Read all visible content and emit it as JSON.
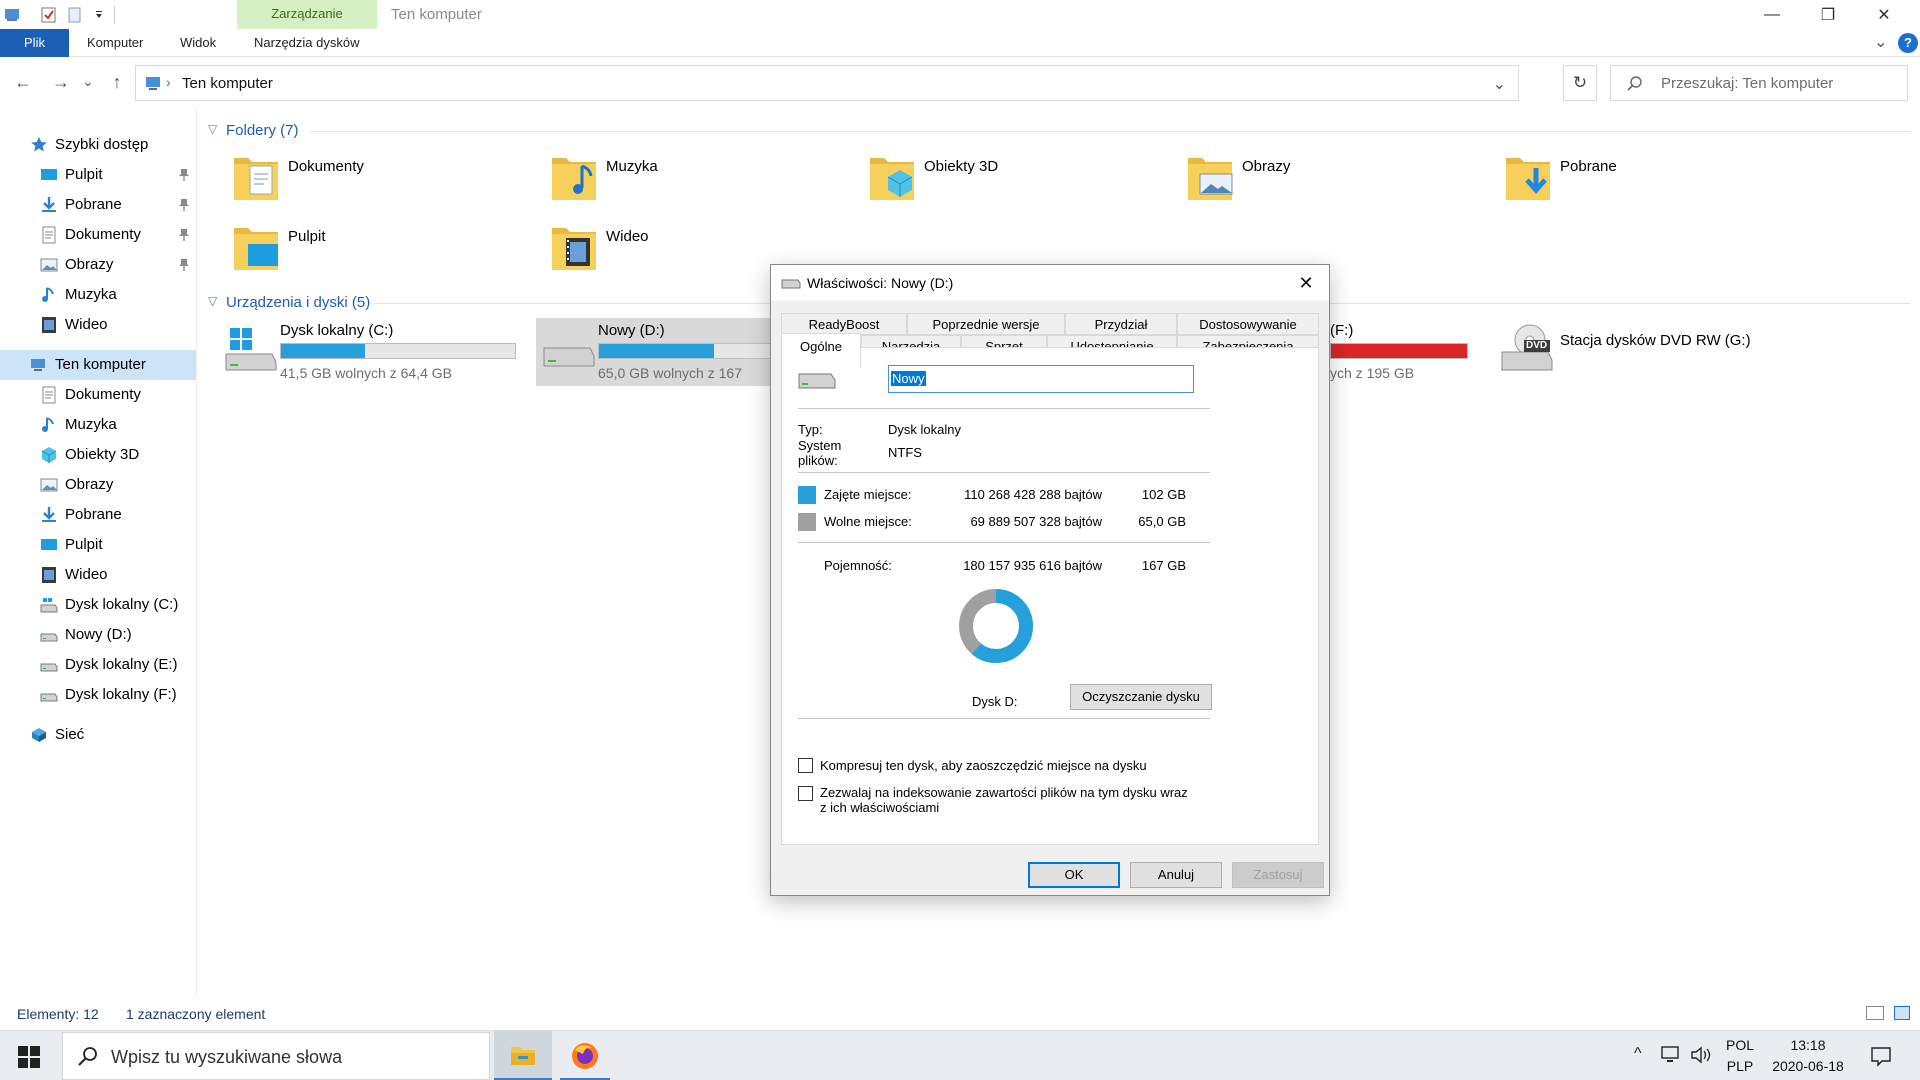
{
  "titlebar": {
    "context_tab": "Zarządzanie",
    "title": "Ten komputer",
    "minimize_glyph": "—",
    "maximize_glyph": "❐",
    "close_glyph": "✕"
  },
  "ribbon": {
    "tabs": [
      "Plik",
      "Komputer",
      "Widok",
      "Narzędzia dysków"
    ],
    "expand_glyph": "⌄",
    "help_glyph": "?"
  },
  "address": {
    "path": "Ten komputer",
    "separator": "›",
    "search_placeholder": "Przeszukaj: Ten komputer",
    "back_glyph": "←",
    "forward_glyph": "→",
    "recent_glyph": "⌄",
    "up_glyph": "↑",
    "dropdown_glyph": "⌄",
    "refresh_glyph": "↻"
  },
  "sidebar": {
    "items": [
      {
        "label": "Szybki dostęp",
        "icon": "star-icon",
        "pinned": false
      },
      {
        "label": "Pulpit",
        "icon": "desktop-icon",
        "pinned": true
      },
      {
        "label": "Pobrane",
        "icon": "download-icon",
        "pinned": true
      },
      {
        "label": "Dokumenty",
        "icon": "document-icon",
        "pinned": true
      },
      {
        "label": "Obrazy",
        "icon": "pictures-icon",
        "pinned": true
      },
      {
        "label": "Muzyka",
        "icon": "music-icon",
        "pinned": false
      },
      {
        "label": "Wideo",
        "icon": "video-icon",
        "pinned": false
      },
      {
        "label": "Ten komputer",
        "icon": "computer-icon",
        "pinned": false
      },
      {
        "label": "Dokumenty",
        "icon": "document-icon",
        "pinned": false
      },
      {
        "label": "Muzyka",
        "icon": "music-icon",
        "pinned": false
      },
      {
        "label": "Obiekty 3D",
        "icon": "objects-3d-icon",
        "pinned": false
      },
      {
        "label": "Obrazy",
        "icon": "pictures-icon",
        "pinned": false
      },
      {
        "label": "Pobrane",
        "icon": "download-icon",
        "pinned": false
      },
      {
        "label": "Pulpit",
        "icon": "desktop-icon",
        "pinned": false
      },
      {
        "label": "Wideo",
        "icon": "video-icon",
        "pinned": false
      },
      {
        "label": "Dysk lokalny (C:)",
        "icon": "drive-c-icon",
        "pinned": false
      },
      {
        "label": "Nowy (D:)",
        "icon": "drive-icon",
        "pinned": false
      },
      {
        "label": "Dysk lokalny (E:)",
        "icon": "drive-icon",
        "pinned": false
      },
      {
        "label": "Dysk lokalny (F:)",
        "icon": "drive-icon",
        "pinned": false
      },
      {
        "label": "Sieć",
        "icon": "network-icon",
        "pinned": false
      }
    ]
  },
  "content": {
    "folders_header": "Foldery (7)",
    "devices_header": "Urządzenia i dyski (5)",
    "folders": [
      {
        "name": "Dokumenty",
        "icon": "documents-folder-icon"
      },
      {
        "name": "Muzyka",
        "icon": "music-folder-icon"
      },
      {
        "name": "Obiekty 3D",
        "icon": "objects-3d-folder-icon"
      },
      {
        "name": "Obrazy",
        "icon": "pictures-folder-icon"
      },
      {
        "name": "Pobrane",
        "icon": "downloads-folder-icon"
      },
      {
        "name": "Pulpit",
        "icon": "desktop-folder-icon"
      },
      {
        "name": "Wideo",
        "icon": "videos-folder-icon"
      }
    ],
    "drives": [
      {
        "name": "Dysk lokalny (C:)",
        "free": "41,5 GB wolnych z 64,4 GB",
        "used_fraction": 0.36,
        "bar_color": "#26a0da"
      },
      {
        "name": "Nowy (D:)",
        "free": "65,0 GB wolnych z 167",
        "used_fraction": 0.61,
        "bar_color": "#26a0da"
      },
      {
        "name": "(F:)",
        "free": "ych z 195 GB",
        "used_fraction": 1.0,
        "bar_color": "#da2626"
      },
      {
        "name": "Stacja dysków DVD RW (G:)",
        "free": "",
        "used_fraction": null,
        "bar_color": ""
      }
    ],
    "dvd_label": "DVD"
  },
  "status": {
    "count": "Elementy: 12",
    "selected": "1 zaznaczony element"
  },
  "dialog": {
    "title": "Właściwości: Nowy (D:)",
    "close_glyph": "✕",
    "tabs_row1": [
      "ReadyBoost",
      "Poprzednie wersje",
      "Przydział",
      "Dostosowywanie"
    ],
    "tabs_row2": [
      "Ogólne",
      "Narzędzia",
      "Sprzęt",
      "Udostępnianie",
      "Zabezpieczenia"
    ],
    "name_value": "Nowy",
    "type_label": "Typ:",
    "type_value": "Dysk lokalny",
    "fs_label_1": "System",
    "fs_label_2": "plików:",
    "fs_value": "NTFS",
    "used_label": "Zajęte miejsce:",
    "used_bytes": "110 268 428 288 bajtów",
    "used_gb": "102 GB",
    "free_label": "Wolne miejsce:",
    "free_bytes": "69 889 507 328 bajtów",
    "free_gb": "65,0 GB",
    "capacity_label": "Pojemność:",
    "capacity_bytes": "180 157 935 616 bajtów",
    "capacity_gb": "167 GB",
    "used_color": "#26a0da",
    "free_color": "#a0a0a0",
    "used_fraction": 0.612,
    "drive_label": "Dysk D:",
    "cleanup_button": "Oczyszczanie dysku",
    "compress_label": "Kompresuj ten dysk, aby zaoszczędzić miejsce na dysku",
    "index_label_1": "Zezwalaj na indeksowanie zawartości plików na tym dysku wraz",
    "index_label_2": "z ich właściwościami",
    "compress_checked": false,
    "index_checked": false,
    "ok_button": "OK",
    "cancel_button": "Anuluj",
    "apply_button": "Zastosuj"
  },
  "taskbar": {
    "search_placeholder": "Wpisz tu wyszukiwane słowa",
    "language_1": "POL",
    "language_2": "PLP",
    "time": "13:18",
    "date": "2020-06-18",
    "tray_chevron": "^"
  }
}
